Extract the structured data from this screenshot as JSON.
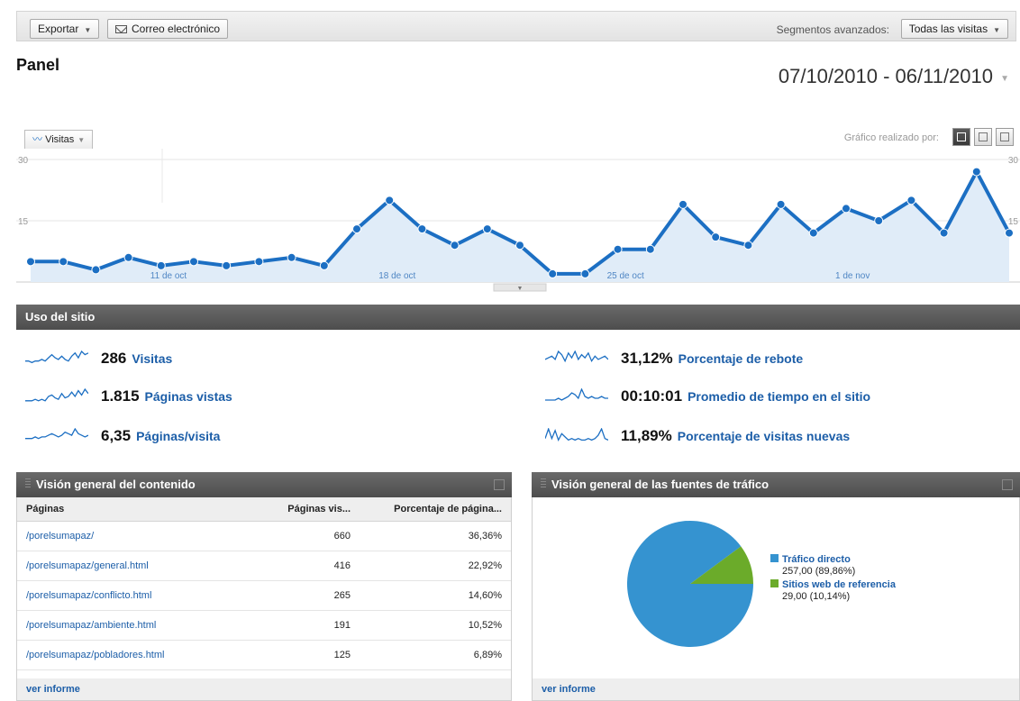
{
  "toolbar": {
    "export_label": "Exportar",
    "email_label": "Correo electrónico",
    "segments_label": "Segmentos avanzados:",
    "segments_value": "Todas las visitas"
  },
  "page": {
    "title": "Panel",
    "date_range": "07/10/2010 - 06/11/2010"
  },
  "chart_controls": {
    "metric_label": "Visitas",
    "chart_by_label": "Gráfico realizado por:"
  },
  "chart_data": [
    {
      "type": "area",
      "series": [
        {
          "name": "Visitas",
          "values": [
            5,
            5,
            3,
            6,
            4,
            5,
            4,
            5,
            6,
            4,
            13,
            20,
            13,
            9,
            13,
            9,
            2,
            2,
            8,
            8,
            19,
            11,
            9,
            19,
            12,
            18,
            15,
            20,
            12,
            27,
            12
          ],
          "color": "#1c6fc3"
        }
      ],
      "x_tick_labels": [
        "11 de oct",
        "18 de oct",
        "25 de oct",
        "1 de nov"
      ],
      "y_tick_labels": [
        "30",
        "15"
      ],
      "ylim": [
        0,
        30
      ],
      "grid": true
    },
    {
      "type": "pie",
      "categories": [
        "Tráfico directo",
        "Sitios web de referencia"
      ],
      "values": [
        257,
        29
      ],
      "display_values": [
        "257,00 (89,86%)",
        "29,00 (10,14%)"
      ],
      "colors": [
        "#3593d0",
        "#6bab2a"
      ]
    }
  ],
  "site_usage": {
    "title": "Uso del sitio",
    "metrics": [
      {
        "value": "286",
        "label": "Visitas",
        "spark": [
          3,
          3,
          2,
          3,
          3,
          4,
          3,
          5,
          7,
          5,
          4,
          6,
          4,
          3,
          6,
          8,
          5,
          9,
          7,
          8
        ]
      },
      {
        "value": "1.815",
        "label": "Páginas vistas",
        "spark": [
          2,
          2,
          2,
          3,
          2,
          3,
          2,
          5,
          6,
          4,
          3,
          7,
          4,
          5,
          8,
          5,
          9,
          6,
          10,
          7
        ]
      },
      {
        "value": "6,35",
        "label": "Páginas/visita",
        "spark": [
          3,
          3,
          3,
          4,
          3,
          4,
          4,
          5,
          6,
          5,
          4,
          5,
          7,
          6,
          5,
          9,
          6,
          5,
          4,
          5
        ]
      },
      {
        "value": "31,12%",
        "label": "Porcentaje de rebote",
        "spark": [
          4,
          5,
          6,
          4,
          9,
          7,
          3,
          8,
          5,
          9,
          4,
          7,
          5,
          8,
          3,
          6,
          4,
          5,
          6,
          4
        ]
      },
      {
        "value": "00:10:01",
        "label": "Promedio de tiempo en el sitio",
        "spark": [
          2,
          2,
          2,
          2,
          3,
          2,
          3,
          4,
          6,
          5,
          3,
          8,
          4,
          3,
          4,
          3,
          3,
          4,
          3,
          3
        ]
      },
      {
        "value": "11,89%",
        "label": "Porcentaje de visitas nuevas",
        "spark": [
          3,
          9,
          3,
          8,
          2,
          6,
          4,
          2,
          3,
          2,
          3,
          2,
          2,
          3,
          2,
          3,
          5,
          9,
          3,
          2
        ]
      }
    ]
  },
  "content_overview": {
    "title": "Visión general del contenido",
    "headers": [
      "Páginas",
      "Páginas vis...",
      "Porcentaje de página..."
    ],
    "rows": [
      [
        "/porelsumapaz/",
        "660",
        "36,36%"
      ],
      [
        "/porelsumapaz/general.html",
        "416",
        "22,92%"
      ],
      [
        "/porelsumapaz/conflicto.html",
        "265",
        "14,60%"
      ],
      [
        "/porelsumapaz/ambiente.html",
        "191",
        "10,52%"
      ],
      [
        "/porelsumapaz/pobladores.html",
        "125",
        "6,89%"
      ]
    ],
    "footer_link": "ver informe"
  },
  "traffic_overview": {
    "title": "Visión general de las fuentes de tráfico",
    "footer_link": "ver informe"
  }
}
